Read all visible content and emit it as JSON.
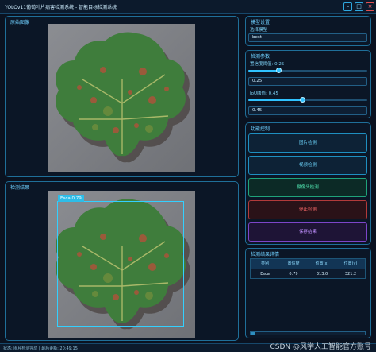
{
  "window": {
    "title": "YOLOv11葡萄叶片病害检测系统 - 智能目标检测系统",
    "minimize_icon": "minimize-icon",
    "maximize_icon": "maximize-icon",
    "close_icon": "close-icon"
  },
  "original_panel": {
    "title": "原始图像"
  },
  "result_panel": {
    "title": "检测结果",
    "detection_label": "Esca 0.79"
  },
  "model_settings": {
    "title": "模型设置",
    "select_label": "选择模型",
    "selected_model": "best"
  },
  "detection_params": {
    "title": "检测参数",
    "confidence_label": "置信度阈值: 0.25",
    "confidence_value": "0.25",
    "confidence_fraction": 0.25,
    "iou_label": "IoU阈值: 0.45",
    "iou_value": "0.45",
    "iou_fraction": 0.45
  },
  "function_panel": {
    "title": "功能控制",
    "image_detect": "图片检测",
    "video_detect": "视频检测",
    "camera_detect": "摄像头检测",
    "stop_detect": "停止检测",
    "save_result": "保存结果"
  },
  "details_panel": {
    "title": "检测结果详情",
    "columns": [
      "类别",
      "置信度",
      "位置(x)",
      "位置(y)"
    ],
    "rows": [
      [
        "Esca",
        "0.79",
        "313.0",
        "321.2"
      ]
    ]
  },
  "status": {
    "text": "状态: 图片检测完成 | 最后更新: 20:49:15"
  },
  "watermark": "CSDN @风学人工智能官方账号",
  "colors": {
    "accent": "#2fc2ff",
    "background": "#0a1220",
    "stop_red": "#ff6b6b",
    "save_purple": "#c190ff",
    "detect_green": "#4fe0ad"
  }
}
